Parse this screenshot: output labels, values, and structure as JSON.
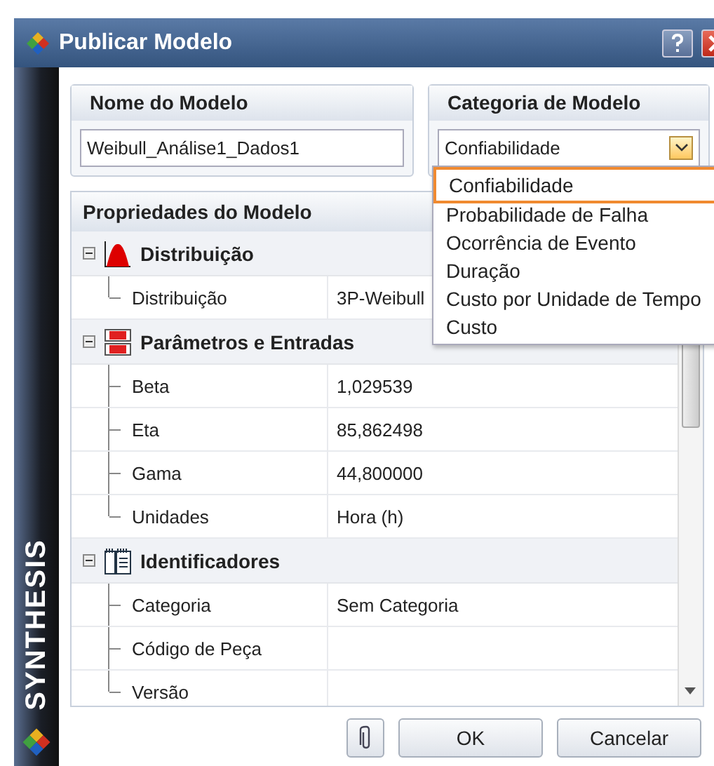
{
  "window": {
    "title": "Publicar Modelo"
  },
  "brand": "SYNTHESIS",
  "model_name": {
    "label": "Nome do Modelo",
    "value": "Weibull_Análise1_Dados1"
  },
  "category": {
    "label": "Categoria de Modelo",
    "value": "Confiabilidade",
    "expanded": true,
    "options": [
      {
        "label": "Confiabilidade",
        "selected": true
      },
      {
        "label": "Probabilidade de Falha",
        "selected": false
      },
      {
        "label": "Ocorrência de Evento",
        "selected": false
      },
      {
        "label": "Duração",
        "selected": false
      },
      {
        "label": "Custo por Unidade de Tempo",
        "selected": false
      },
      {
        "label": "Custo",
        "selected": false
      }
    ]
  },
  "properties": {
    "title": "Propriedades do Modelo",
    "groups": [
      {
        "name": "Distribuição",
        "kind": "distribution",
        "expanded": true,
        "rows": [
          {
            "label": "Distribuição",
            "value": "3P-Weibull"
          }
        ]
      },
      {
        "name": "Parâmetros e Entradas",
        "kind": "parameters",
        "expanded": true,
        "rows": [
          {
            "label": "Beta",
            "value": "1,029539"
          },
          {
            "label": "Eta",
            "value": "85,862498"
          },
          {
            "label": "Gama",
            "value": "44,800000"
          },
          {
            "label": "Unidades",
            "value": "Hora (h)"
          }
        ]
      },
      {
        "name": "Identificadores",
        "kind": "identifiers",
        "expanded": true,
        "rows": [
          {
            "label": "Categoria",
            "value": "Sem Categoria"
          },
          {
            "label": "Código de Peça"
          },
          {
            "label": "Versão"
          }
        ]
      }
    ]
  },
  "buttons": [
    "OK",
    "Cancelar"
  ]
}
